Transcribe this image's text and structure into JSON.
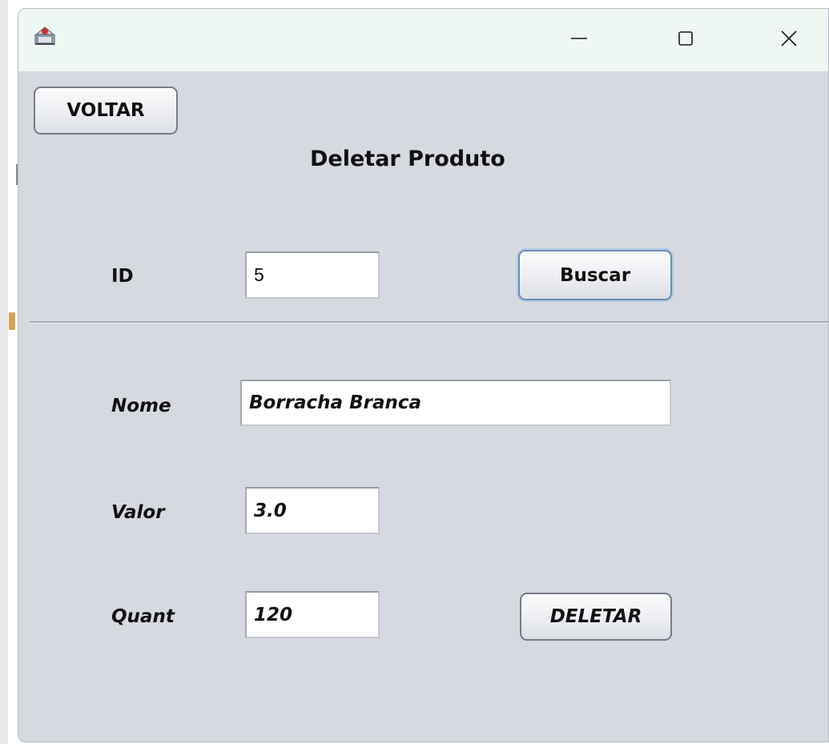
{
  "window": {
    "icon": "java-app-icon",
    "controls": {
      "minimize_icon": "minimize-icon",
      "maximize_icon": "maximize-icon",
      "close_icon": "close-icon"
    }
  },
  "form": {
    "back_button": "VOLTAR",
    "title": "Deletar Produto",
    "id_label": "ID",
    "id_value": "5",
    "search_button": "Buscar",
    "name_label": "Nome",
    "name_value": "Borracha Branca",
    "price_label": "Valor",
    "price_value": "3.0",
    "quantity_label": "Quant",
    "quantity_value": "120",
    "delete_button": "DELETAR"
  },
  "colors": {
    "window_background": "#d6d9e0",
    "titlebar_background": "#eff7f2",
    "focus_ring": "#6d8db4"
  }
}
